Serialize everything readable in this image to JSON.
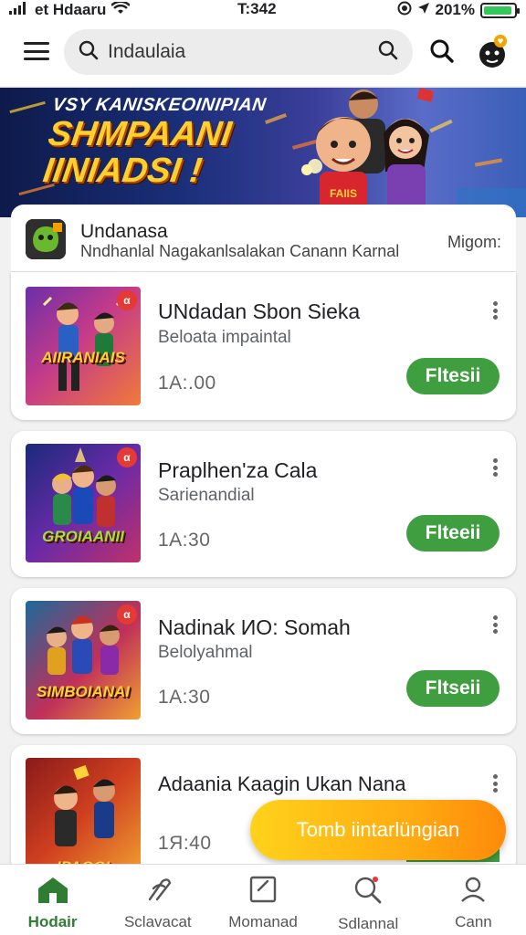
{
  "status_bar": {
    "carrier": "et Hdaaru",
    "time": "T:342",
    "battery_text": "201%",
    "battery_level": 0.95,
    "icons": [
      "signal-icon",
      "wifi-icon",
      "focus-icon",
      "location-icon",
      "battery-icon"
    ]
  },
  "appbar": {
    "menu_icon": "hamburger-icon",
    "search_value": "Indaulaia",
    "search_icon": "search-icon",
    "action_icon": "search-icon",
    "avatar_icon": "profile-icon"
  },
  "banner": {
    "subtitle": "VSY KANISKEOINIPIAN",
    "title_line1": "SHMPAANI",
    "title_line2": "IINIADSI !",
    "jersey_text": "FAIIS"
  },
  "list_header": {
    "title": "Undanasa",
    "subtitle": "Nndhanlal Nagakanlsalakan Canann Karnal",
    "meta": "Migom:"
  },
  "games": [
    {
      "title": "UNdadan Sbon Sieka",
      "subtitle": "Beloata impaintal",
      "time": "1A:.00",
      "button": "Fltesii",
      "thumb_text": "AIIRANIAIS",
      "badge": "α"
    },
    {
      "title": "Praplhen'za Cala",
      "subtitle": "Sarienandial",
      "time": "1A:30",
      "button": "Flteeii",
      "thumb_text": "GROIAANII",
      "badge": "α"
    },
    {
      "title": "Nadinak ИО: Somah",
      "subtitle": "Belolyahmal",
      "time": "1A:30",
      "button": "Fltseii",
      "thumb_text": "SIMBOIANAI",
      "badge": "α"
    },
    {
      "title": "Adaania Kaagin Ukan Nana",
      "subtitle": "",
      "time": "1Я:40",
      "button": "",
      "thumb_text": "IPAGGI",
      "badge": ""
    }
  ],
  "fab": {
    "label": "Tomb iintarlüngian"
  },
  "bottom_nav": [
    {
      "label": "Hodair",
      "icon": "home-icon",
      "active": true
    },
    {
      "label": "Sclavacat",
      "icon": "explore-icon",
      "active": false
    },
    {
      "label": "Momanad",
      "icon": "note-icon",
      "active": false
    },
    {
      "label": "Sdlannal",
      "icon": "search-icon",
      "active": false
    },
    {
      "label": "Cann",
      "icon": "person-icon",
      "active": false
    }
  ],
  "colors": {
    "accent_green": "#3f9e3f",
    "nav_active": "#2e7d32",
    "fab_start": "#ffd21a",
    "fab_end": "#ff8a0a",
    "banner_title": "#ffcf2e"
  }
}
